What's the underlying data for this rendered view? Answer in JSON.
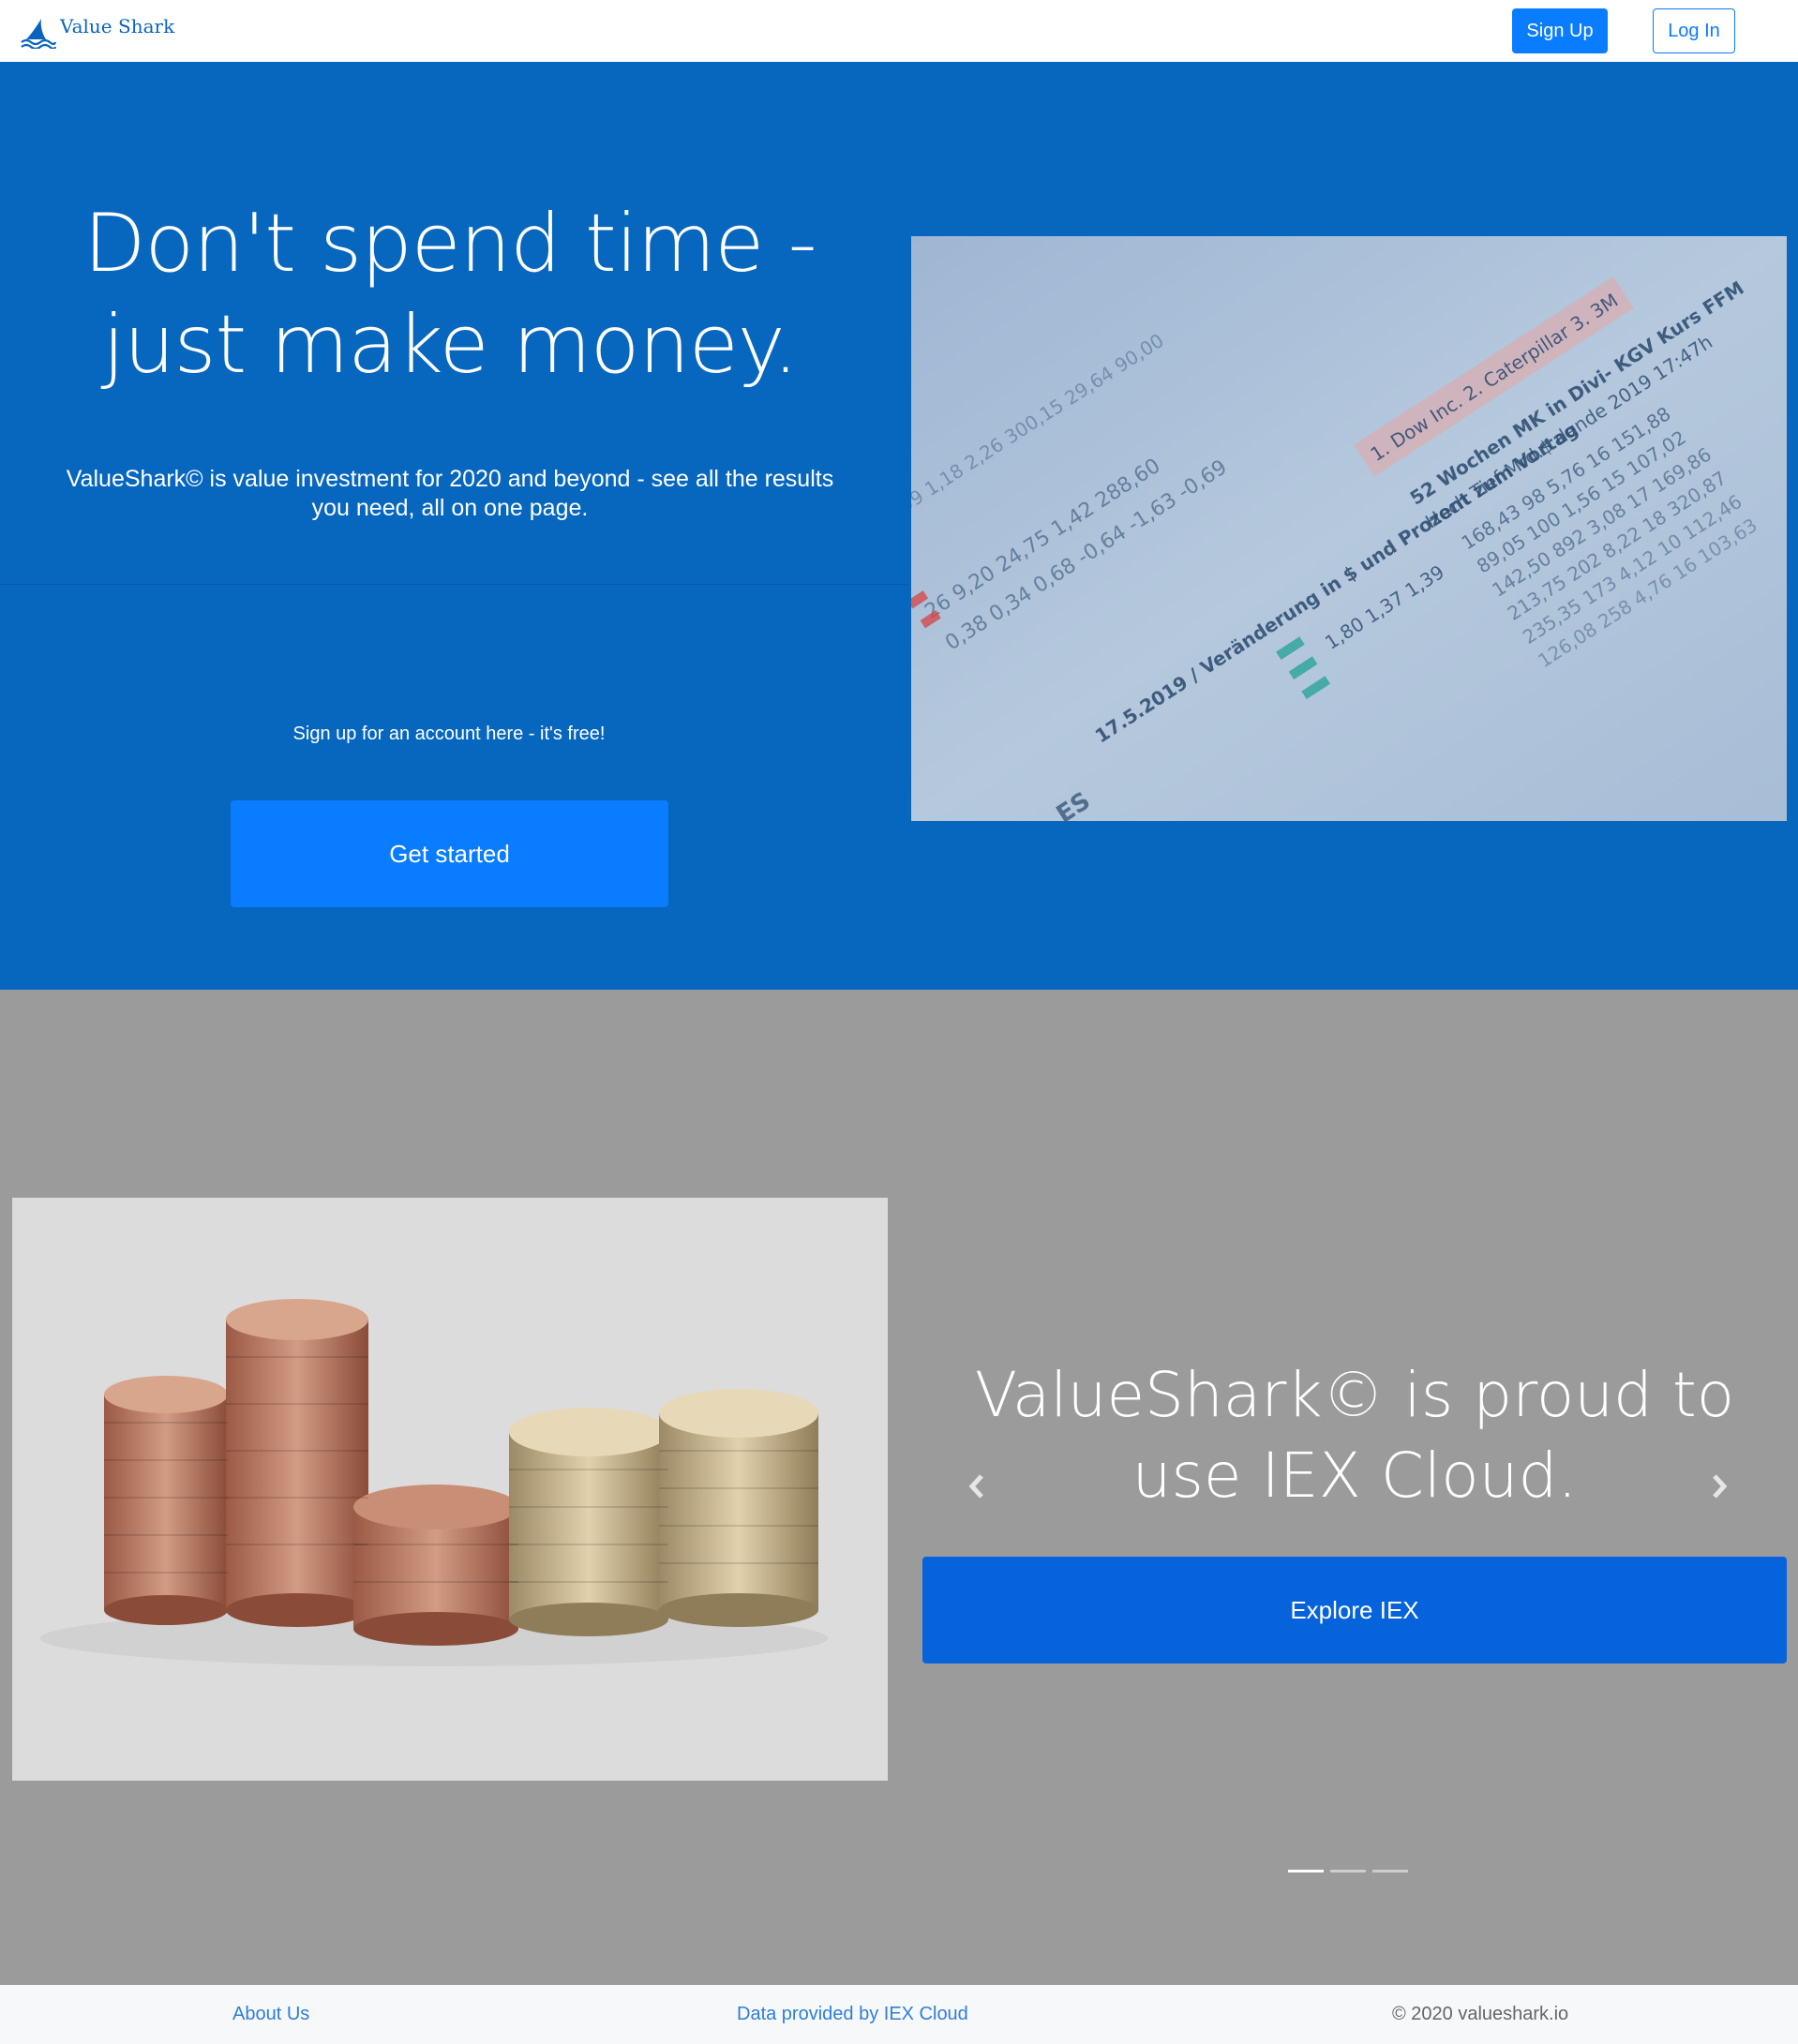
{
  "navbar": {
    "brand": "Value Shark",
    "signup_label": "Sign Up",
    "login_label": "Log In"
  },
  "hero": {
    "title": "Don't spend time - just make money.",
    "subtitle": "ValueShark© is value investment for 2020 and beyond - see all the results you need, all on one page.",
    "signup_prompt": "Sign up for an account here - it's free!",
    "cta_label": "Get started",
    "image": "financial-newspaper-stock-table"
  },
  "carousel": {
    "title": "ValueShark© is proud to use IEX Cloud.",
    "cta_label": "Explore IEX",
    "image": "stacked-coins",
    "indicators": [
      true,
      false,
      false
    ]
  },
  "footer": {
    "about": "About Us",
    "data_provider": "Data provided by IEX Cloud",
    "copyright": "© 2020 valueshark.io"
  },
  "colors": {
    "brand_blue": "#0767bf",
    "primary_button": "#0a7cff",
    "section_gray": "#9b9b9b",
    "footer_bg": "#f7f8fa"
  }
}
